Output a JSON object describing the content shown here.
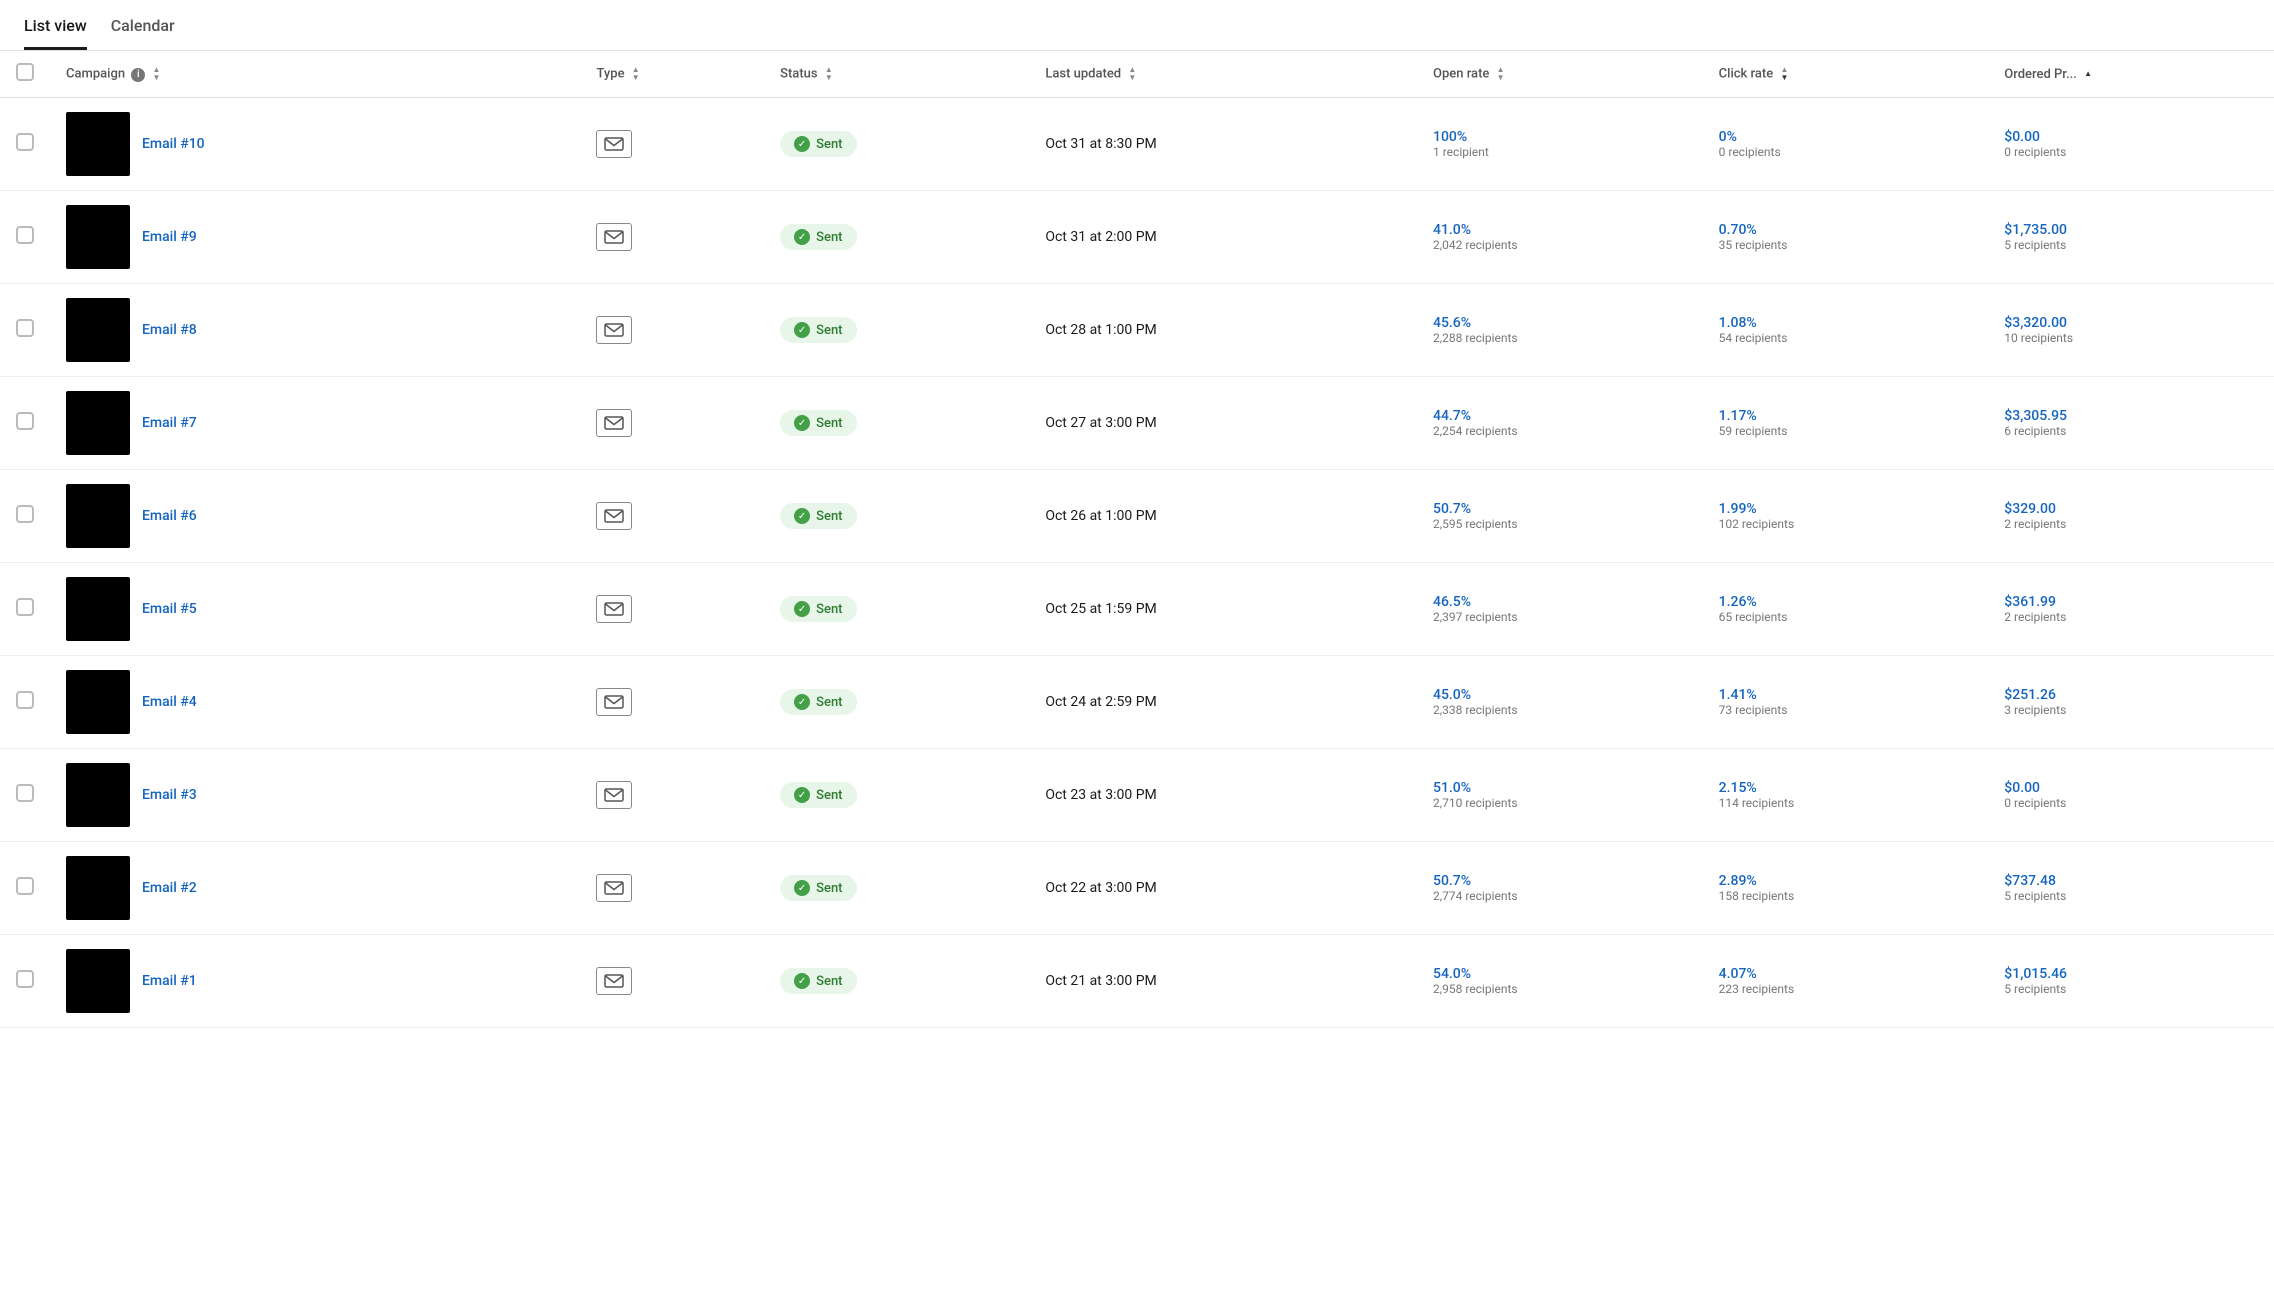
{
  "tabs": [
    {
      "label": "List view",
      "active": true
    },
    {
      "label": "Calendar",
      "active": false
    }
  ],
  "columns": {
    "campaign": "Campaign",
    "type": "Type",
    "status": "Status",
    "last_updated": "Last updated",
    "open_rate": "Open rate",
    "click_rate": "Click rate",
    "ordered_pr": "Ordered Pr..."
  },
  "rows": [
    {
      "name": "Email #10",
      "type_icon": "email",
      "status": "Sent",
      "last_updated": "Oct 31 at 8:30 PM",
      "open_rate_pct": "100%",
      "open_rate_sub": "1 recipient",
      "click_rate_pct": "0%",
      "click_rate_sub": "0 recipients",
      "ordered_value": "$0.00",
      "ordered_sub": "0 recipients"
    },
    {
      "name": "Email #9",
      "type_icon": "email",
      "status": "Sent",
      "last_updated": "Oct 31 at 2:00 PM",
      "open_rate_pct": "41.0%",
      "open_rate_sub": "2,042 recipients",
      "click_rate_pct": "0.70%",
      "click_rate_sub": "35 recipients",
      "ordered_value": "$1,735.00",
      "ordered_sub": "5 recipients"
    },
    {
      "name": "Email #8",
      "type_icon": "email",
      "status": "Sent",
      "last_updated": "Oct 28 at 1:00 PM",
      "open_rate_pct": "45.6%",
      "open_rate_sub": "2,288 recipients",
      "click_rate_pct": "1.08%",
      "click_rate_sub": "54 recipients",
      "ordered_value": "$3,320.00",
      "ordered_sub": "10 recipients"
    },
    {
      "name": "Email #7",
      "type_icon": "email",
      "status": "Sent",
      "last_updated": "Oct 27 at 3:00 PM",
      "open_rate_pct": "44.7%",
      "open_rate_sub": "2,254 recipients",
      "click_rate_pct": "1.17%",
      "click_rate_sub": "59 recipients",
      "ordered_value": "$3,305.95",
      "ordered_sub": "6 recipients"
    },
    {
      "name": "Email #6",
      "type_icon": "email",
      "status": "Sent",
      "last_updated": "Oct 26 at 1:00 PM",
      "open_rate_pct": "50.7%",
      "open_rate_sub": "2,595 recipients",
      "click_rate_pct": "1.99%",
      "click_rate_sub": "102 recipients",
      "ordered_value": "$329.00",
      "ordered_sub": "2 recipients"
    },
    {
      "name": "Email #5",
      "type_icon": "email",
      "status": "Sent",
      "last_updated": "Oct 25 at 1:59 PM",
      "open_rate_pct": "46.5%",
      "open_rate_sub": "2,397 recipients",
      "click_rate_pct": "1.26%",
      "click_rate_sub": "65 recipients",
      "ordered_value": "$361.99",
      "ordered_sub": "2 recipients"
    },
    {
      "name": "Email #4",
      "type_icon": "email",
      "status": "Sent",
      "last_updated": "Oct 24 at 2:59 PM",
      "open_rate_pct": "45.0%",
      "open_rate_sub": "2,338 recipients",
      "click_rate_pct": "1.41%",
      "click_rate_sub": "73 recipients",
      "ordered_value": "$251.26",
      "ordered_sub": "3 recipients"
    },
    {
      "name": "Email #3",
      "type_icon": "email",
      "status": "Sent",
      "last_updated": "Oct 23 at 3:00 PM",
      "open_rate_pct": "51.0%",
      "open_rate_sub": "2,710 recipients",
      "click_rate_pct": "2.15%",
      "click_rate_sub": "114 recipients",
      "ordered_value": "$0.00",
      "ordered_sub": "0 recipients"
    },
    {
      "name": "Email #2",
      "type_icon": "email",
      "status": "Sent",
      "last_updated": "Oct 22 at 3:00 PM",
      "open_rate_pct": "50.7%",
      "open_rate_sub": "2,774 recipients",
      "click_rate_pct": "2.89%",
      "click_rate_sub": "158 recipients",
      "ordered_value": "$737.48",
      "ordered_sub": "5 recipients"
    },
    {
      "name": "Email #1",
      "type_icon": "email",
      "status": "Sent",
      "last_updated": "Oct 21 at 3:00 PM",
      "open_rate_pct": "54.0%",
      "open_rate_sub": "2,958 recipients",
      "click_rate_pct": "4.07%",
      "click_rate_sub": "223 recipients",
      "ordered_value": "$1,015.46",
      "ordered_sub": "5 recipients"
    }
  ]
}
